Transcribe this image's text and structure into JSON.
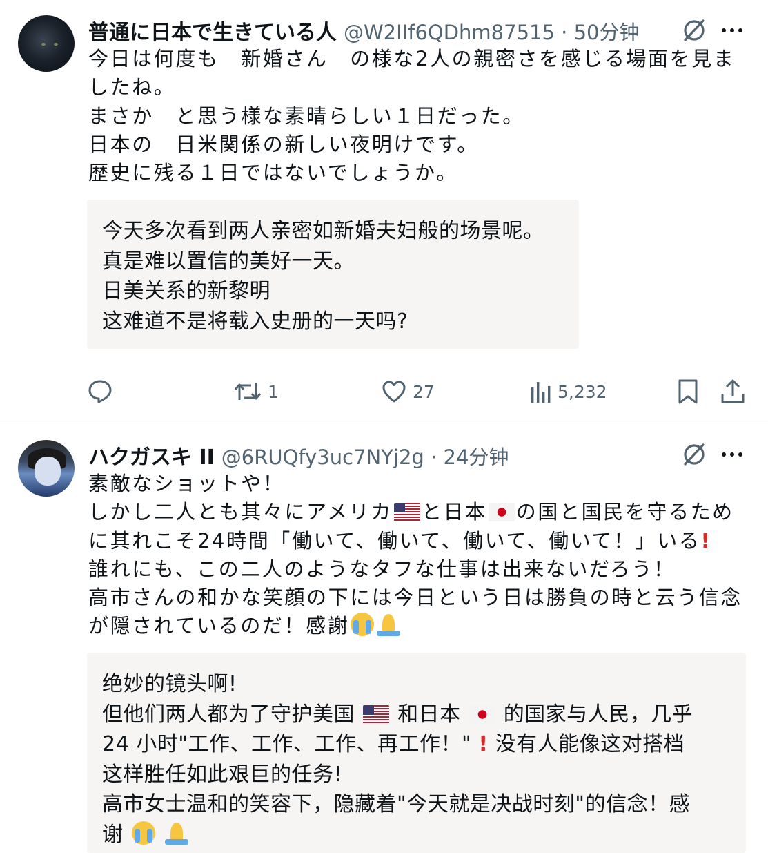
{
  "tweets": [
    {
      "name": "普通に日本で生きている人",
      "meta": "@W2IIf6QDhm87515 · 50分钟",
      "text": "今日は何度も　新婚さん　の様な2人の親密さを感じる場面を見ましたね。\nまさか　と思う様な素晴らしい１日だった。\n日本の　日米関係の新しい夜明けです。\n歴史に残る１日ではないでしょうか。",
      "translation": "今天多次看到两人亲密如新婚夫妇般的场景呢。\n真是难以置信的美好一天。\n日美关系的新黎明\n这难道不是将载入史册的一天吗?",
      "actions": {
        "replies": "",
        "retweets": "1",
        "likes": "27",
        "views": "5,232"
      }
    },
    {
      "name": "ハクガスキ II",
      "meta": "@6RUQfy3uc7NYj2g · 24分钟",
      "text": {
        "l1": "素敵なショットや！",
        "l2a": "しかし二人とも其々にアメリカ",
        "l2b": "と日本",
        "l2c": "の国と国民を守るため",
        "l3a": "に其れこそ24時間「働いて、働いて、働いて、働いて！」いる",
        "l4": "誰れにも、この二人のようなタフな仕事は出来ないだろう！",
        "l5": "高市さんの和かな笑顔の下には今日という日は勝負の時と云う信念",
        "l6": "が隠されているのだ！感謝"
      },
      "translation": {
        "l1": "绝妙的镜头啊!",
        "l2a": "但他们两人都为了守护美国",
        "l2b": "和日本",
        "l2c": "的国家与人民，几乎",
        "l3a": "24 小时\"工作、工作、工作、再工作！\"",
        "l3b": "没有人能像这对搭档",
        "l4": "这样胜任如此艰巨的任务!",
        "l5": "高市女士温和的笑容下，隐藏着\"今天就是决战时刻\"的信念！感",
        "l6": "谢"
      }
    }
  ],
  "icons": {
    "grok": "grok-slash-icon",
    "more": "more-horizontal-icon",
    "reply": "reply-bubble-icon",
    "retweet": "retweet-icon",
    "like": "heart-icon",
    "views": "bar-chart-icon",
    "bookmark": "bookmark-icon",
    "share": "share-upload-icon",
    "flag_us": "us-flag-emoji",
    "flag_jp": "japan-flag-emoji",
    "exclamation": "red-exclamation-emoji",
    "crying": "loudly-crying-face-emoji",
    "praying": "folded-hands-emoji"
  },
  "colors": {
    "text": "#0f1419",
    "secondary": "#536471",
    "translation_bg": "#f6f5f3",
    "divider": "#eff3f4"
  }
}
